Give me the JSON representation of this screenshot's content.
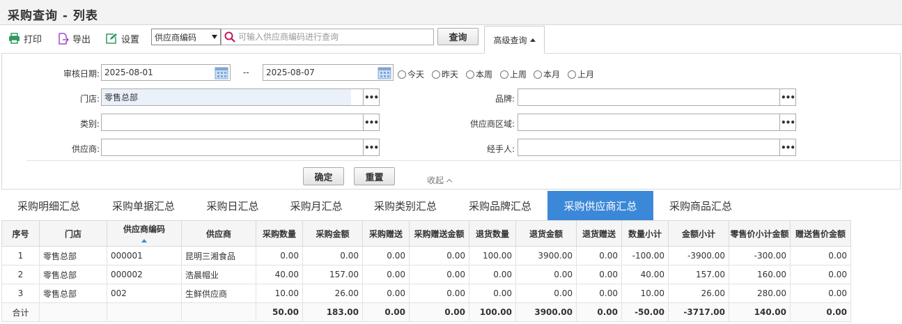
{
  "page_title": "采购查询 - 列表",
  "toolbar": {
    "print_label": "打印",
    "export_label": "导出",
    "settings_label": "设置",
    "field_select_value": "供应商编码",
    "search_placeholder": "可输入供应商编码进行查询",
    "query_label": "查询",
    "advanced_label": "高级查询"
  },
  "filters": {
    "date_label": "审核日期:",
    "date_from": "2025-08-01",
    "date_sep": "--",
    "date_to": "2025-08-07",
    "quick_dates": [
      "今天",
      "昨天",
      "本周",
      "上周",
      "本月",
      "上月"
    ],
    "store_label": "门店:",
    "store_value": "零售总部",
    "brand_label": "品牌:",
    "brand_value": "",
    "category_label": "类别:",
    "category_value": "",
    "region_label": "供应商区域:",
    "region_value": "",
    "supplier_label": "供应商:",
    "supplier_value": "",
    "handler_label": "经手人:",
    "handler_value": "",
    "confirm_label": "确定",
    "reset_label": "重置",
    "collapse_label": "收起"
  },
  "tabs": [
    "采购明细汇总",
    "采购单据汇总",
    "采购日汇总",
    "采购月汇总",
    "采购类别汇总",
    "采购品牌汇总",
    "采购供应商汇总",
    "采购商品汇总"
  ],
  "active_tab": "采购供应商汇总",
  "table": {
    "columns": [
      "序号",
      "门店",
      "供应商编码",
      "供应商",
      "采购数量",
      "采购金额",
      "采购赠送",
      "采购赠送金额",
      "退货数量",
      "退货金额",
      "退货赠送",
      "数量小计",
      "金额小计",
      "零售价小计金额",
      "赠送售价金额"
    ],
    "rows": [
      [
        "1",
        "零售总部",
        "000001",
        "昆明三湘食品",
        "0.00",
        "0.00",
        "0.00",
        "0.00",
        "100.00",
        "3900.00",
        "0.00",
        "-100.00",
        "-3900.00",
        "-300.00",
        "0.00"
      ],
      [
        "2",
        "零售总部",
        "000002",
        "浩晨帽业",
        "40.00",
        "157.00",
        "0.00",
        "0.00",
        "0.00",
        "0.00",
        "0.00",
        "40.00",
        "157.00",
        "160.00",
        "0.00"
      ],
      [
        "3",
        "零售总部",
        "002",
        "生鲜供应商",
        "10.00",
        "26.00",
        "0.00",
        "0.00",
        "0.00",
        "0.00",
        "0.00",
        "10.00",
        "26.00",
        "280.00",
        "0.00"
      ]
    ],
    "total": [
      "合计",
      "",
      "",
      "",
      "50.00",
      "183.00",
      "0.00",
      "0.00",
      "100.00",
      "3900.00",
      "0.00",
      "-50.00",
      "-3717.00",
      "140.00",
      "0.00"
    ]
  },
  "colors": {
    "accent": "#3c88d8",
    "icon_green": "#2e9b5e",
    "icon_purple": "#a04bc6",
    "search_icon": "#c2185b"
  }
}
